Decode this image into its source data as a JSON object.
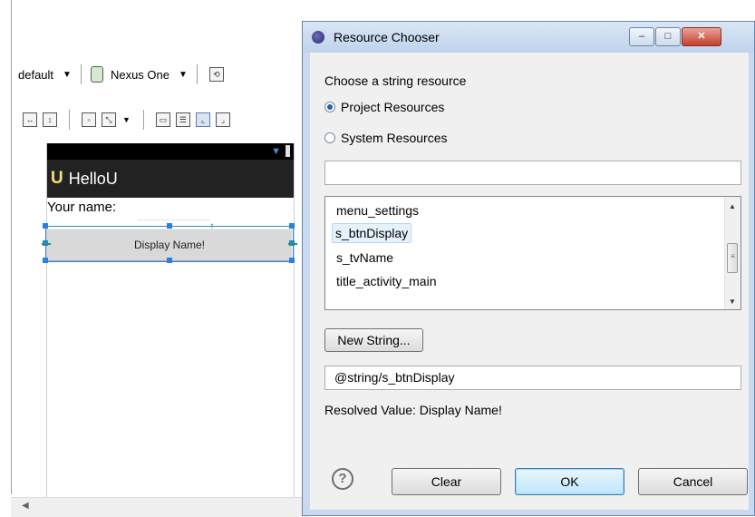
{
  "editor": {
    "toolbar": {
      "theme_label": "default",
      "device_label": "Nexus One"
    },
    "preview": {
      "app_title": "HelloU",
      "app_logo": "U",
      "your_name_label": "Your name:",
      "display_button_label": "Display Name!"
    }
  },
  "dialog": {
    "title": "Resource Chooser",
    "window_buttons": {
      "minimize": "–",
      "maximize": "□",
      "close": "✕"
    },
    "prompt": "Choose a string resource",
    "radios": [
      {
        "label": "Project Resources",
        "checked": true
      },
      {
        "label": "System Resources",
        "checked": false
      }
    ],
    "filter_value": "",
    "resources": [
      {
        "name": "menu_settings",
        "selected": false
      },
      {
        "name": "s_btnDisplay",
        "selected": true
      },
      {
        "name": "s_tvName",
        "selected": false
      },
      {
        "name": "title_activity_main",
        "selected": false
      }
    ],
    "new_string_label": "New String...",
    "result_value": "@string/s_btnDisplay",
    "resolved_value": "Resolved Value: Display Name!",
    "help_icon": "?",
    "buttons": {
      "clear": "Clear",
      "ok": "OK",
      "cancel": "Cancel"
    }
  },
  "colors": {
    "dialog_frame": "#c9daf0",
    "selection_blue": "#2a7fe0",
    "guide_green": "#1aa04a"
  }
}
